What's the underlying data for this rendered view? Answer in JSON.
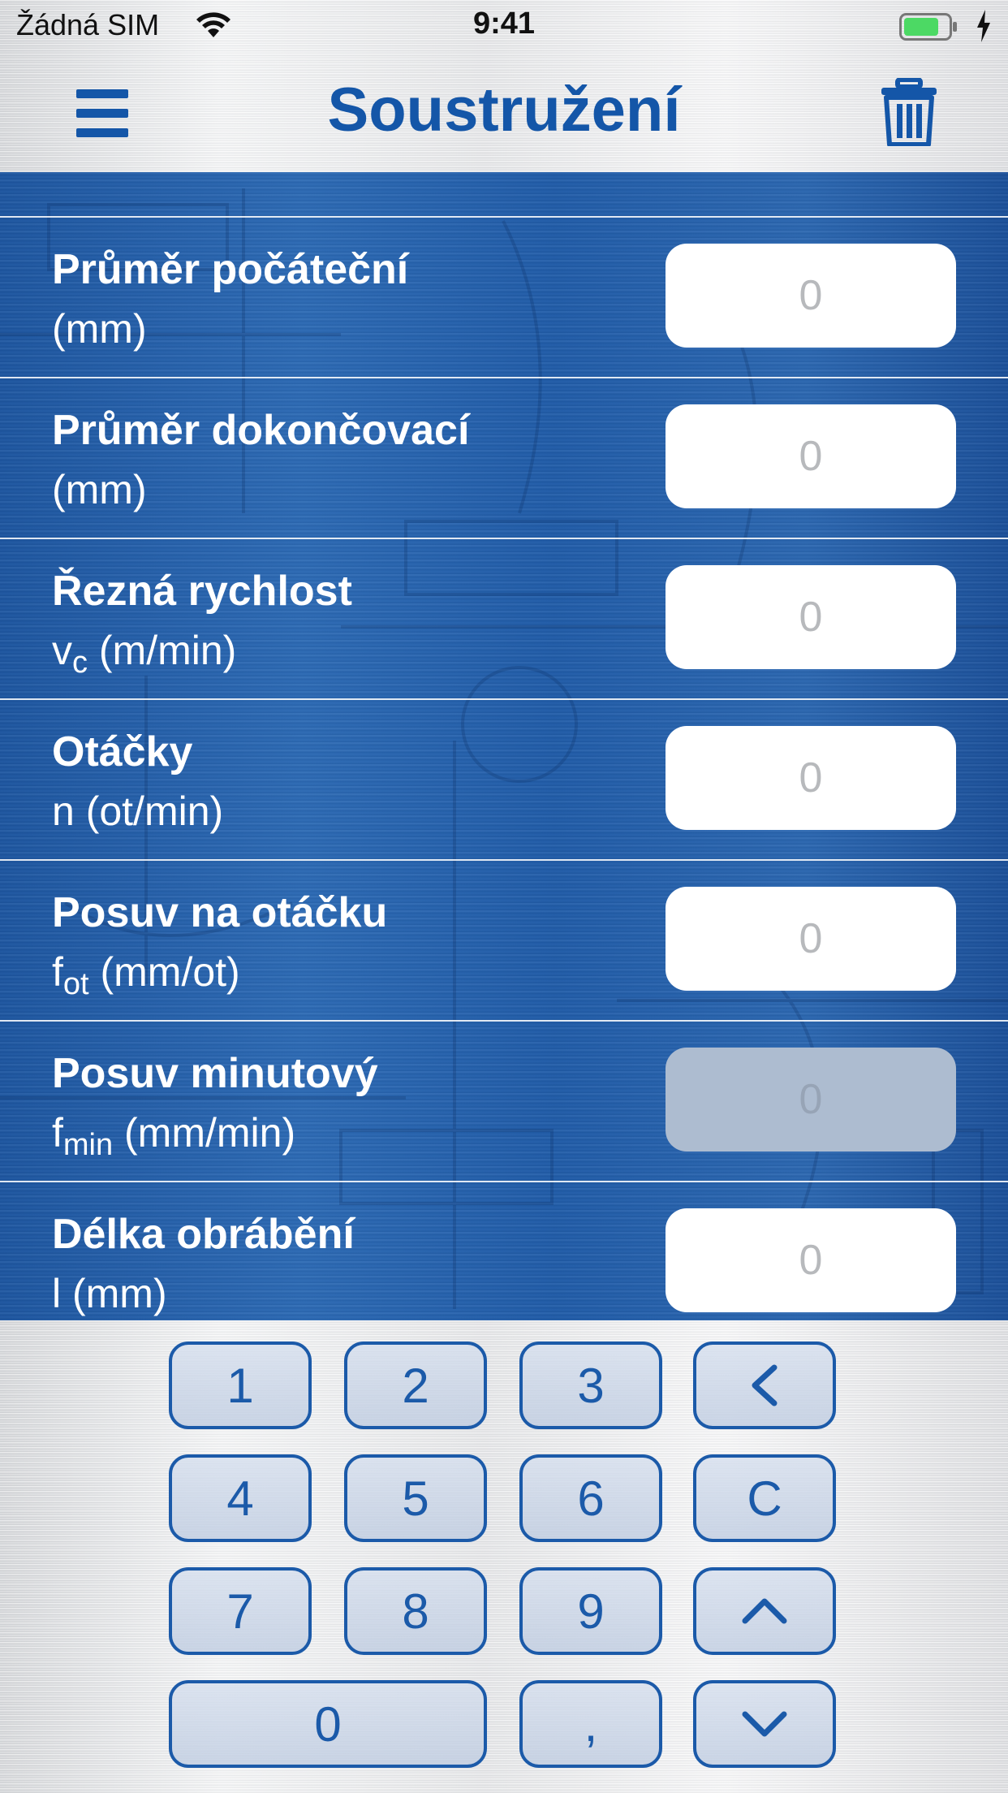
{
  "status_bar": {
    "carrier": "Žádná SIM",
    "time": "9:41"
  },
  "header": {
    "title": "Soustružení"
  },
  "form": {
    "rows": [
      {
        "title": "Průměr počáteční",
        "unit": "(mm)",
        "unit_sub": "",
        "unit_rest": "",
        "value": "0",
        "enabled": true
      },
      {
        "title": "Průměr dokončovací",
        "unit": "(mm)",
        "unit_sub": "",
        "unit_rest": "",
        "value": "0",
        "enabled": true
      },
      {
        "title": "Řezná rychlost",
        "unit": "v",
        "unit_sub": "c",
        "unit_rest": " (m/min)",
        "value": "0",
        "enabled": true
      },
      {
        "title": "Otáčky",
        "unit": "n (ot/min)",
        "unit_sub": "",
        "unit_rest": "",
        "value": "0",
        "enabled": true
      },
      {
        "title": "Posuv na otáčku",
        "unit": "f",
        "unit_sub": "ot",
        "unit_rest": " (mm/ot)",
        "value": "0",
        "enabled": true
      },
      {
        "title": "Posuv minutový",
        "unit": "f",
        "unit_sub": "min",
        "unit_rest": " (mm/min)",
        "value": "0",
        "enabled": false
      },
      {
        "title": "Délka obrábění",
        "unit": "l (mm)",
        "unit_sub": "",
        "unit_rest": "",
        "value": "0",
        "enabled": true
      }
    ]
  },
  "keypad": {
    "keys": [
      "1",
      "2",
      "3",
      "<",
      "4",
      "5",
      "6",
      "C",
      "7",
      "8",
      "9",
      "^",
      "0",
      ",",
      "v"
    ]
  },
  "colors": {
    "accent": "#1456a8",
    "form_background": "#2060ac",
    "field_background": "#ffffff",
    "field_disabled": "#adbcd0",
    "battery": "#4cd964"
  }
}
